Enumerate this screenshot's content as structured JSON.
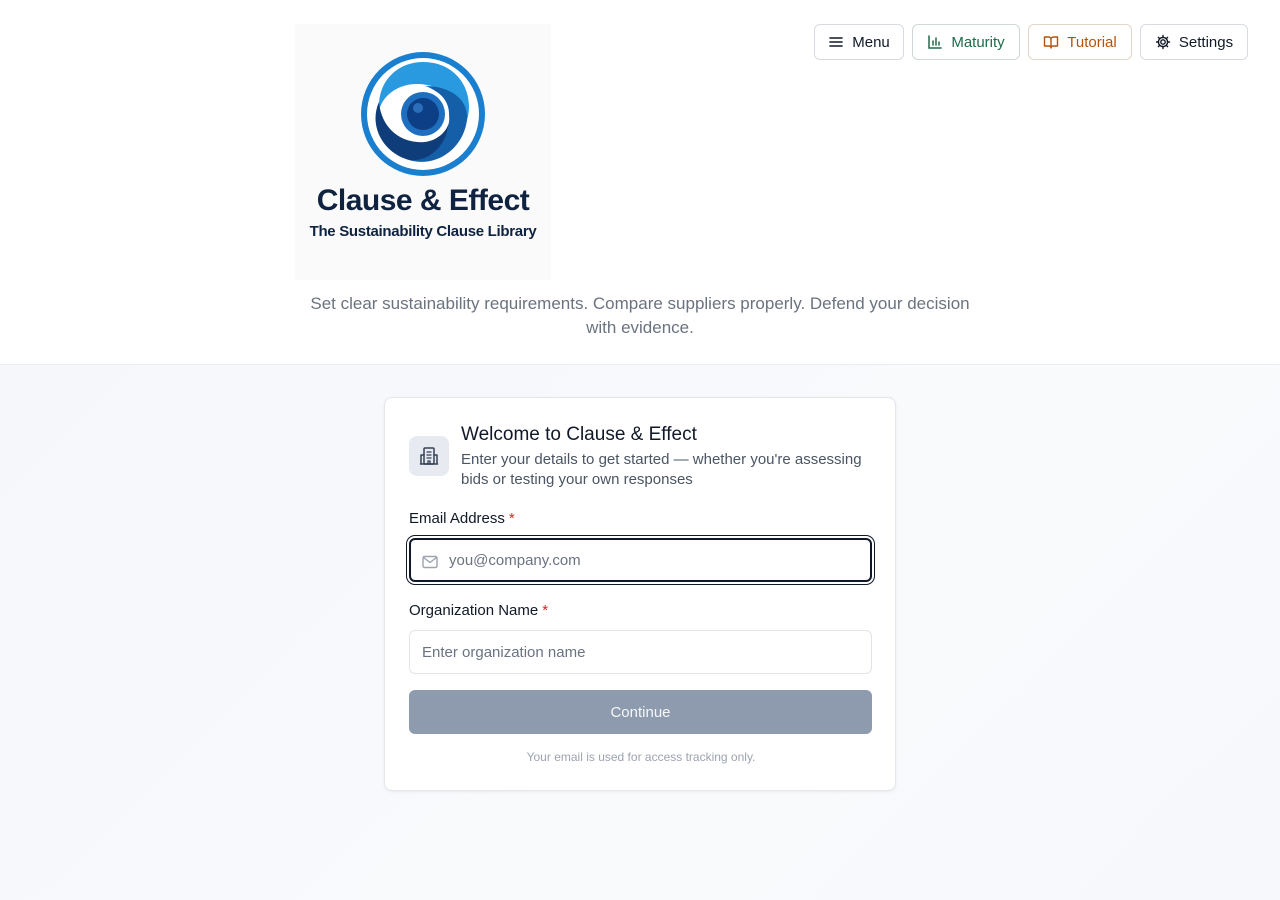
{
  "brand": {
    "logo_title": "Clause & Effect",
    "logo_subtitle": "The Sustainability Clause Library",
    "tagline": "Set clear sustainability requirements. Compare suppliers properly. Defend your decision with evidence."
  },
  "nav": {
    "menu": "Menu",
    "maturity": "Maturity",
    "tutorial": "Tutorial",
    "settings": "Settings"
  },
  "card": {
    "title": "Welcome to Clause & Effect",
    "description": "Enter your details to get started — whether you're assessing bids or testing your own responses",
    "email_label": "Email Address",
    "email_placeholder": "you@company.com",
    "email_value": "",
    "org_label": "Organization Name",
    "org_placeholder": "Enter organization name",
    "org_value": "",
    "required_mark": "*",
    "continue": "Continue",
    "note": "Your email is used for access tracking only."
  },
  "colors": {
    "brand_navy": "#0f2340",
    "maturity_green": "#1f6b4a",
    "tutorial_orange": "#b45309",
    "continue_disabled": "#8e9aae",
    "required_red": "#dc2626"
  },
  "icons": {
    "menu": "menu-icon",
    "maturity": "bar-chart-icon",
    "tutorial": "book-open-icon",
    "settings": "gear-icon",
    "card": "building-icon",
    "email": "mail-icon"
  }
}
